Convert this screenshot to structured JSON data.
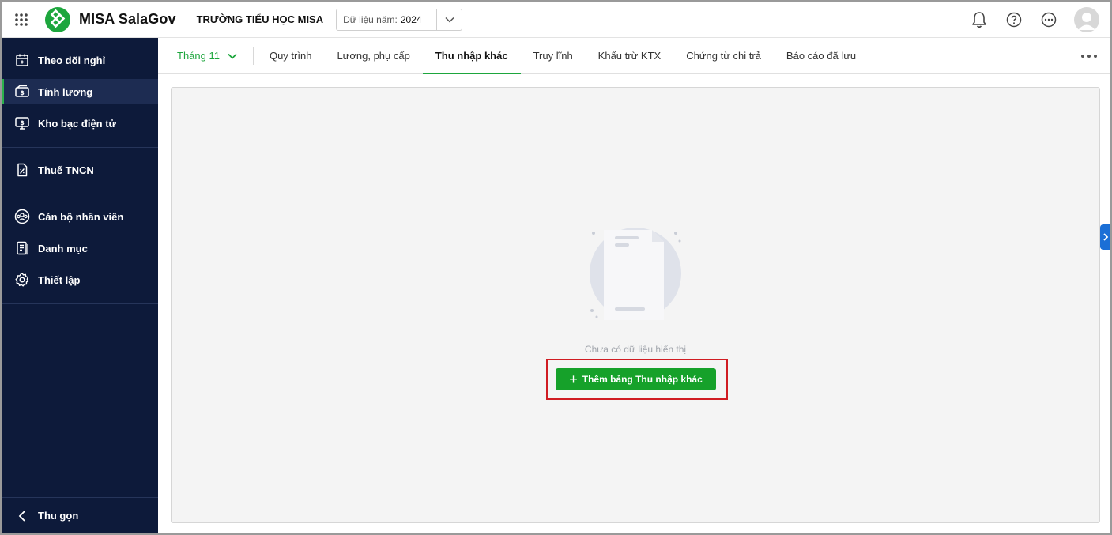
{
  "header": {
    "app_title": "MISA SalaGov",
    "org_name": "TRƯỜNG TIỂU HỌC MISA",
    "year_label": "Dữ liệu năm:",
    "year_value": "2024"
  },
  "sidebar": {
    "items": [
      {
        "label": "Theo dõi nghỉ",
        "icon": "calendar-icon",
        "active": false
      },
      {
        "label": "Tính lương",
        "icon": "salary-icon",
        "active": true
      },
      {
        "label": "Kho bạc điện tử",
        "icon": "treasury-icon",
        "active": false
      },
      {
        "label": "Thuế TNCN",
        "icon": "tax-icon",
        "active": false
      },
      {
        "label": "Cán bộ nhân viên",
        "icon": "staff-icon",
        "active": false
      },
      {
        "label": "Danh mục",
        "icon": "catalog-icon",
        "active": false
      },
      {
        "label": "Thiết lập",
        "icon": "gear-icon",
        "active": false
      }
    ],
    "collapse_label": "Thu gọn"
  },
  "tabs": {
    "month": "Tháng 11",
    "items": [
      {
        "label": "Quy trình"
      },
      {
        "label": "Lương, phụ cấp"
      },
      {
        "label": "Thu nhập khác",
        "active": true
      },
      {
        "label": "Truy lĩnh"
      },
      {
        "label": "Khấu trừ KTX"
      },
      {
        "label": "Chứng từ chi trả"
      },
      {
        "label": "Báo cáo đã lưu"
      }
    ]
  },
  "content": {
    "empty_text": "Chưa có dữ liệu hiển thị",
    "add_button_label": "Thêm bảng Thu nhập khác"
  },
  "colors": {
    "sidebar_bg": "#0d1a3a",
    "accent_green": "#1da63d",
    "highlight_red": "#d01c22",
    "toggle_blue": "#1b6fd6"
  }
}
